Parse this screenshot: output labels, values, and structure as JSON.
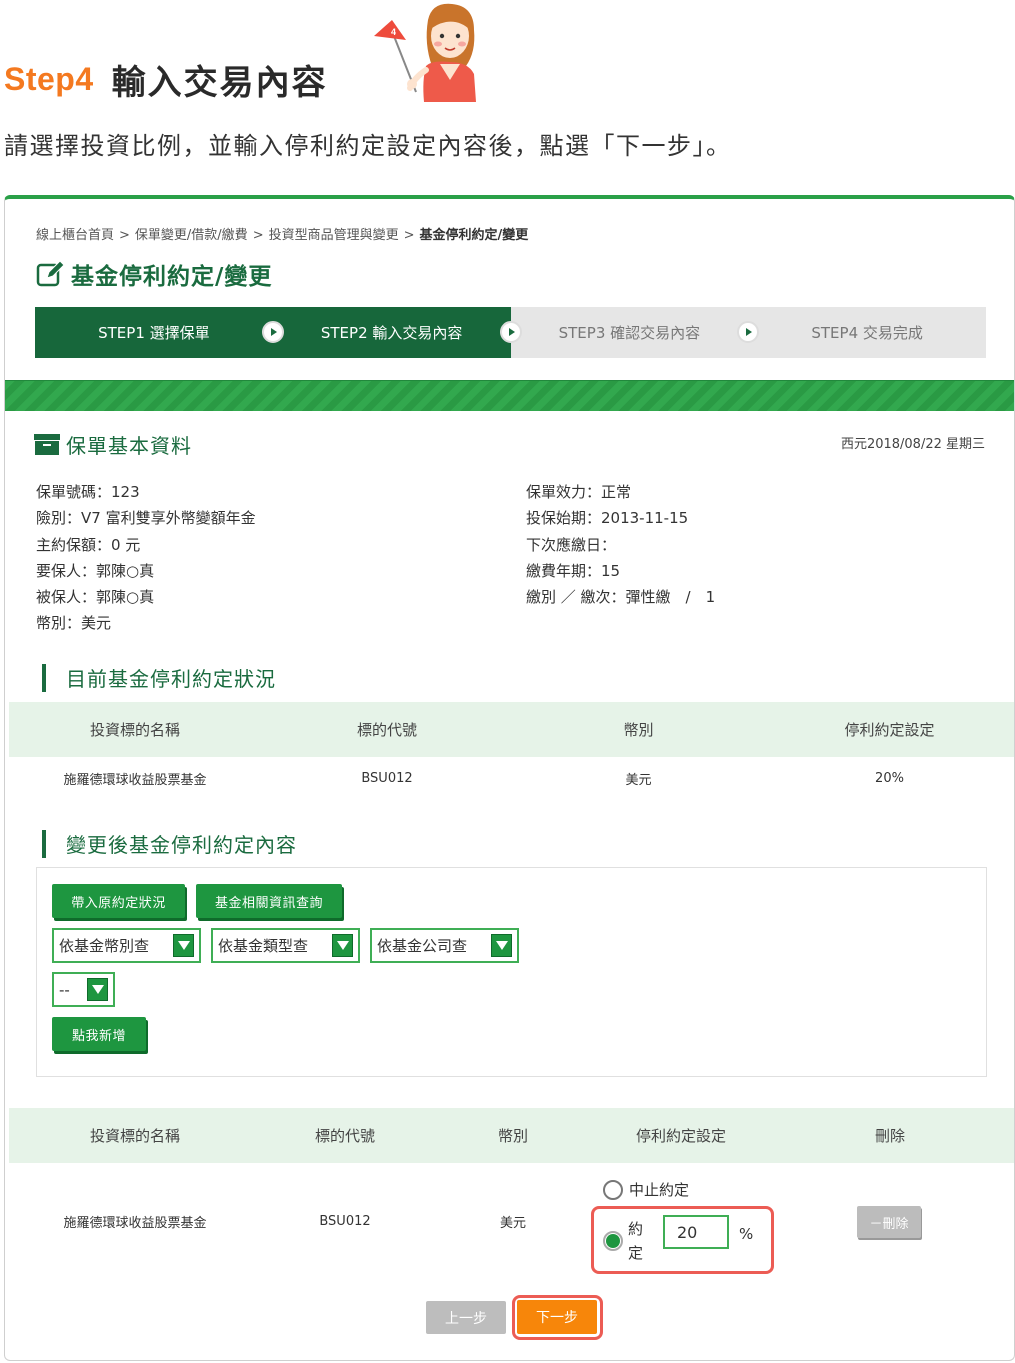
{
  "tutorial": {
    "step_label": "Step4",
    "heading": "輸入交易內容",
    "flag_number": "4",
    "description": "請選擇投資比例，並輸入停利約定設定內容後，點選「下一步」。"
  },
  "breadcrumb": [
    "線上櫃台首頁",
    "保單變更/借款/繳費",
    "投資型商品管理與變更",
    "基金停利約定/變更"
  ],
  "breadcrumb_sep": ">",
  "page_title": "基金停利約定/變更",
  "steps": [
    {
      "label": "STEP1 選擇保單",
      "state": "active"
    },
    {
      "label": "STEP2 輸入交易內容",
      "state": "active"
    },
    {
      "label": "STEP3 確認交易內容",
      "state": "inactive"
    },
    {
      "label": "STEP4 交易完成",
      "state": "inactive"
    }
  ],
  "basic_info": {
    "title": "保單基本資料",
    "date": "西元2018/08/22 星期三",
    "left": [
      "保單號碼：123",
      "險別：V7 富利雙享外幣變額年金",
      "主約保額：0 元",
      "要保人：郭陳○真",
      "被保人：郭陳○真",
      "幣別：美元"
    ],
    "right": [
      "保單效力：正常",
      "投保始期：2013-11-15",
      "下次應繳日：",
      "繳費年期：15",
      "繳別 ／ 繳次：彈性繳　/　1"
    ]
  },
  "current_status": {
    "title": "目前基金停利約定狀況",
    "headers": [
      "投資標的名稱",
      "標的代號",
      "幣別",
      "停利約定設定"
    ],
    "rows": [
      [
        "施羅德環球收益股票基金",
        "BSU012",
        "美元",
        "20%"
      ]
    ]
  },
  "change": {
    "title": "變更後基金停利約定內容",
    "btn_load": "帶入原約定狀況",
    "btn_query": "基金相關資訊查詢",
    "select_currency": "依基金幣別查",
    "select_type": "依基金類型查",
    "select_company": "依基金公司查",
    "select_fund": "--",
    "btn_add": "點我新增"
  },
  "after_table": {
    "headers": [
      "投資標的名稱",
      "標的代號",
      "幣別",
      "停利約定設定",
      "刪除"
    ],
    "row": {
      "name": "施羅德環球收益股票基金",
      "code": "BSU012",
      "currency": "美元",
      "opt_stop": "中止約定",
      "opt_agree_1": "約",
      "opt_agree_2": "定",
      "percent_value": "20",
      "percent_sign": "%",
      "delete_label": "－刪除"
    }
  },
  "nav": {
    "prev": "上一步",
    "next": "下一步"
  },
  "colors": {
    "brand_green": "#1a6b3f",
    "accent_orange": "#f47920",
    "highlight_red": "#ec5c54"
  }
}
